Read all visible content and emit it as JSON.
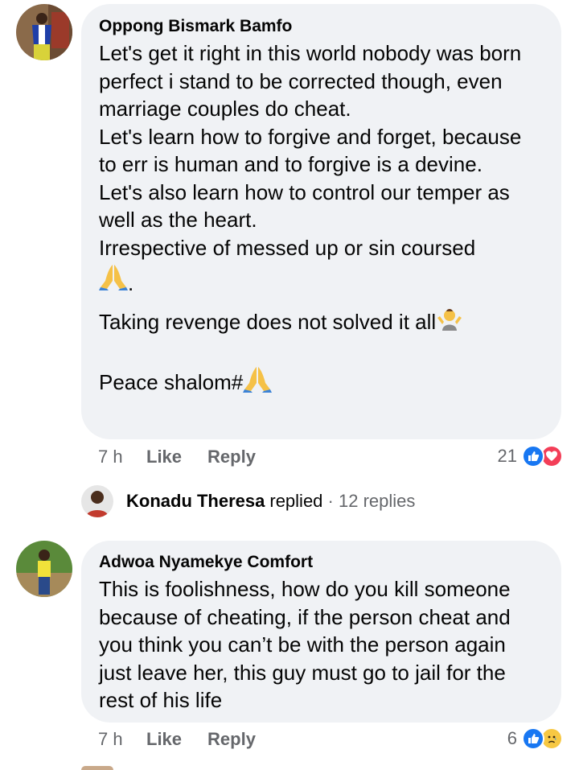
{
  "comments": [
    {
      "author": "Oppong Bismark Bamfo",
      "paragraphs": [
        "Let's get it right in this world nobody was born perfect i stand to be corrected though, even marriage couples do cheat.",
        "Let's learn how to forgive and forget, because to err is human and to forgive is a devine.",
        "Let's also learn how to control our temper as well as the heart.",
        "Irrespective of messed up or sin coursed"
      ],
      "pray_line_suffix": ".",
      "revenge_line": "Taking revenge does not solved it all",
      "peace_line": "Peace shalom#",
      "time": "7 h",
      "like_label": "Like",
      "reply_label": "Reply",
      "reaction_count": "21",
      "reactions": [
        "like-icon",
        "love-icon"
      ]
    },
    {
      "author": "Adwoa Nyamekye Comfort",
      "text": "This is foolishness, how do you kill someone because of cheating, if the person cheat and you think you can’t be with the person again just leave her, this guy must go to jail for the rest of his life",
      "time": "7 h",
      "like_label": "Like",
      "reply_label": "Reply",
      "reaction_count": "6",
      "reactions": [
        "like-icon",
        "sad-icon"
      ]
    }
  ],
  "reply_summary": {
    "name": "Konadu Theresa",
    "action": "replied",
    "separator": " · ",
    "count": "12 replies"
  },
  "colors": {
    "bubble": "#f0f2f5",
    "muted": "#65676b",
    "like_blue": "#1877f2",
    "love_red": "#f33e58"
  }
}
